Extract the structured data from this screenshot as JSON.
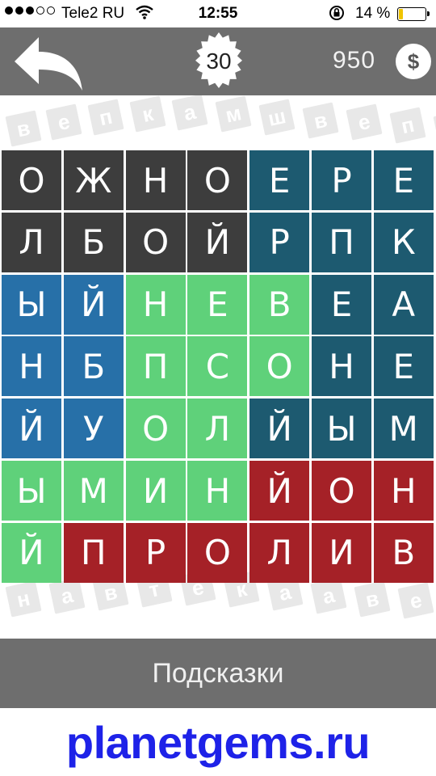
{
  "status": {
    "carrier": "Tele2 RU",
    "time": "12:55",
    "battery": "14 %"
  },
  "header": {
    "level": "30",
    "coins": "950",
    "coin_symbol": "$"
  },
  "colors": {
    "header_bg": "#6e6e6e",
    "dark": "#3d3d3d",
    "teal": "#1d5a70",
    "blue": "#2770a8",
    "green": "#5fd17a",
    "red": "#a52127"
  },
  "background_letters": [
    "в",
    "е",
    "п",
    "к",
    "а",
    "м",
    "ш",
    "в",
    "е",
    "п",
    "т",
    "н",
    "а",
    "в",
    "т",
    "е",
    "к",
    "а",
    "а"
  ],
  "grid": {
    "rows": [
      [
        {
          "l": "О",
          "c": "dark"
        },
        {
          "l": "Ж",
          "c": "dark"
        },
        {
          "l": "Н",
          "c": "dark"
        },
        {
          "l": "О",
          "c": "dark"
        },
        {
          "l": "Е",
          "c": "teal"
        },
        {
          "l": "Р",
          "c": "teal"
        },
        {
          "l": "Е",
          "c": "teal"
        }
      ],
      [
        {
          "l": "Л",
          "c": "dark"
        },
        {
          "l": "Б",
          "c": "dark"
        },
        {
          "l": "О",
          "c": "dark"
        },
        {
          "l": "Й",
          "c": "dark"
        },
        {
          "l": "Р",
          "c": "teal"
        },
        {
          "l": "П",
          "c": "teal"
        },
        {
          "l": "К",
          "c": "teal"
        }
      ],
      [
        {
          "l": "Ы",
          "c": "blue"
        },
        {
          "l": "Й",
          "c": "blue"
        },
        {
          "l": "Н",
          "c": "green"
        },
        {
          "l": "Е",
          "c": "green"
        },
        {
          "l": "В",
          "c": "green"
        },
        {
          "l": "Е",
          "c": "teal"
        },
        {
          "l": "А",
          "c": "teal"
        }
      ],
      [
        {
          "l": "Н",
          "c": "blue"
        },
        {
          "l": "Б",
          "c": "blue"
        },
        {
          "l": "П",
          "c": "green"
        },
        {
          "l": "С",
          "c": "green"
        },
        {
          "l": "О",
          "c": "green"
        },
        {
          "l": "Н",
          "c": "teal"
        },
        {
          "l": "Е",
          "c": "teal"
        }
      ],
      [
        {
          "l": "Й",
          "c": "blue"
        },
        {
          "l": "У",
          "c": "blue"
        },
        {
          "l": "О",
          "c": "green"
        },
        {
          "l": "Л",
          "c": "green"
        },
        {
          "l": "Й",
          "c": "teal"
        },
        {
          "l": "Ы",
          "c": "teal"
        },
        {
          "l": "М",
          "c": "teal"
        }
      ],
      [
        {
          "l": "Ы",
          "c": "green"
        },
        {
          "l": "М",
          "c": "green"
        },
        {
          "l": "И",
          "c": "green"
        },
        {
          "l": "Н",
          "c": "green"
        },
        {
          "l": "Й",
          "c": "red"
        },
        {
          "l": "О",
          "c": "red"
        },
        {
          "l": "Н",
          "c": "red"
        }
      ],
      [
        {
          "l": "Й",
          "c": "green"
        },
        {
          "l": "П",
          "c": "red"
        },
        {
          "l": "Р",
          "c": "red"
        },
        {
          "l": "О",
          "c": "red"
        },
        {
          "l": "Л",
          "c": "red"
        },
        {
          "l": "И",
          "c": "red"
        },
        {
          "l": "В",
          "c": "red"
        }
      ]
    ]
  },
  "hints": {
    "label": "Подсказки"
  },
  "watermark": {
    "site": "planetgems.ru"
  }
}
